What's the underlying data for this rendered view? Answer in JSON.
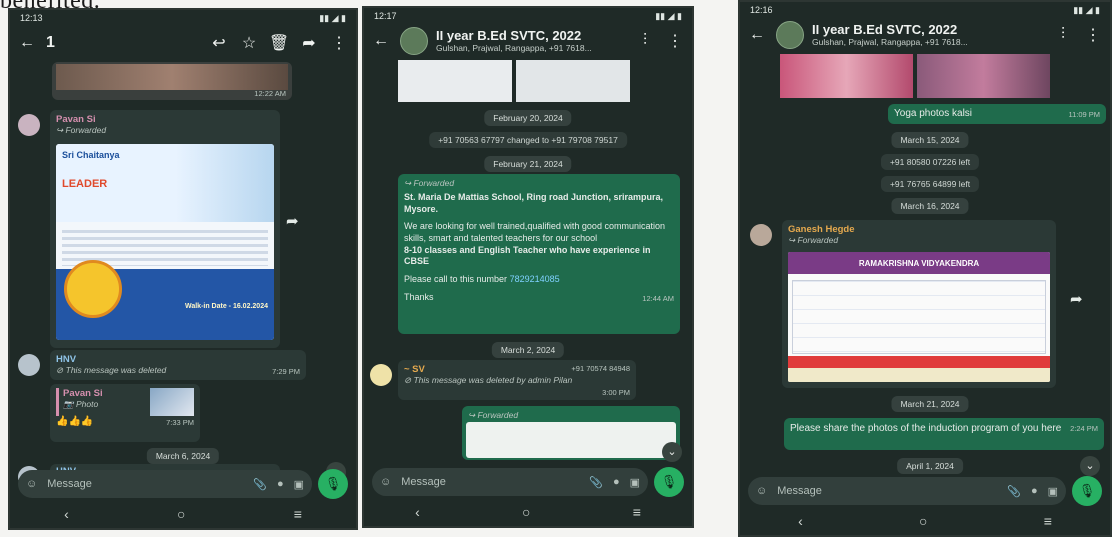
{
  "page_heading_cut": "benefited.",
  "phone1": {
    "status_time": "12:13",
    "selected_count": "1",
    "msg_sender_pavan": "Pavan Si",
    "forwarded_label": "Forwarded",
    "image_time": "12:22 AM",
    "poster_brand": "Sri Chaitanya",
    "poster_leader": "LEADER",
    "poster_walkin": "Walk-in Date - 16.02.2024",
    "hnv_name": "HNV",
    "deleted_text": "This message was deleted",
    "deleted_time": "7:29 PM",
    "reply_sender": "Pavan Si",
    "reply_photo": "Photo",
    "reactions": "👍👍👍",
    "reply_time": "7:33 PM",
    "date_pill": "March 6, 2024",
    "bottom_sender": "HNV",
    "message_placeholder": "Message"
  },
  "phone2": {
    "status_time": "12:17",
    "chat_title": "II year B.Ed SVTC, 2022",
    "chat_subtitle": "Gulshan, Prajwal, Rangappa, +91 7618...",
    "date1": "February 20, 2024",
    "sys_changed": "+91 70563 67797 changed to +91 79708 79517",
    "date2": "February 21, 2024",
    "forwarded_label": "Forwarded",
    "school_line": "St. Maria De Mattias School, Ring road Junction, srirampura, Mysore.",
    "body_text": "We are looking for well trained,qualified with good communication skills, smart and talented teachers for our school",
    "body_bold": "8-10 classes and English Teacher who have experience in CBSE",
    "call_text": "Please call to this number",
    "phone_number": "7829214085",
    "thanks": "Thanks",
    "msg_time": "12:44 AM",
    "date3": "March 2, 2024",
    "sv_name": "~ SV",
    "sv_number": "+91 70574 84948",
    "sv_deleted": "This message was deleted by admin Pilan",
    "sv_time": "3:00 PM",
    "message_placeholder": "Message"
  },
  "phone3": {
    "status_time": "12:16",
    "chat_title": "II year B.Ed SVTC, 2022",
    "chat_subtitle": "Gulshan, Prajwal, Rangappa, +91 7618...",
    "yoga_text": "Yoga photos kalsi",
    "yoga_time": "11:09 PM",
    "date1": "March 15, 2024",
    "sys_left1": "+91 80580 07226 left",
    "sys_left2": "+91 76765 64899 left",
    "date2": "March 16, 2024",
    "ganesh_name": "Ganesh Hegde",
    "forwarded_label": "Forwarded",
    "doc_header": "RAMAKRISHNA VIDYAKENDRA",
    "date3": "March 21, 2024",
    "share_text": "Please share the photos of the induction program of you here",
    "share_time": "2:24 PM",
    "date4": "April 1, 2024",
    "message_placeholder": "Message"
  },
  "colors": {
    "chat_bg": "#1f2a27",
    "outgoing": "#1f6b4c",
    "mic": "#27b063"
  }
}
